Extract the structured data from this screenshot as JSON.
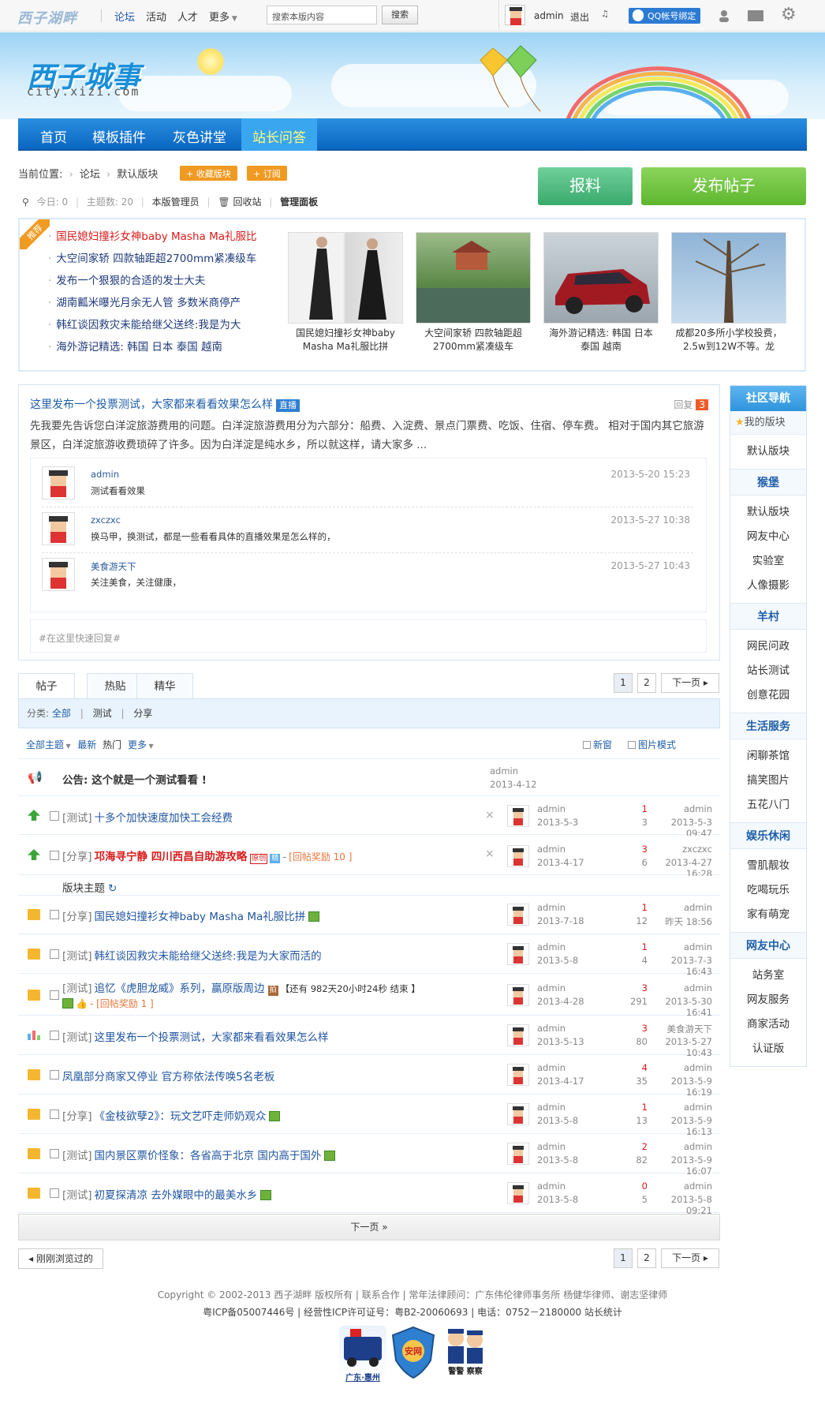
{
  "topbar": {
    "logo": "西子湖畔",
    "nav": [
      "论坛",
      "活动",
      "人才",
      "更多"
    ],
    "search_placeholder": "搜索本版内容",
    "search_button": "搜索",
    "user": "admin",
    "logout": "退出",
    "qq_bind": "QQ帐号绑定"
  },
  "banner": {
    "title": "西子城事",
    "subtitle": "city.xizi.com"
  },
  "mainnav": [
    "首页",
    "模板插件",
    "灰色讲堂",
    "站长问答"
  ],
  "crumb": {
    "label": "当前位置:",
    "forum": "论坛",
    "board": "默认版块",
    "fav": "+ 收藏版块",
    "sub": "+ 订阅"
  },
  "stats": {
    "today": "今日: 0",
    "topics": "主题数: 20",
    "admins": "本版管理员",
    "recycle": "回收站",
    "panel": "管理面板"
  },
  "buttons": {
    "report": "报料",
    "post": "发布帖子"
  },
  "recommend": {
    "tag": "推荐",
    "list": [
      "国民媳妇撞衫女神baby Masha Ma礼服比",
      "大空间家轿 四款轴距超2700mm紧凑级车",
      "发布一个狠狠的合适的发士大夫",
      "湖南瓤米曝光月余无人管 多数米商停产",
      "韩红谈因救灾未能给继父送终:我是为大",
      "海外游记精选: 韩国 日本 泰国 越南"
    ],
    "thumbs": [
      "国民媳妇撞衫女神baby Masha Ma礼服比拼",
      "大空间家轿 四款轴距超2700mm紧凑级车",
      "海外游记精选: 韩国 日本 泰国 越南",
      "成都20多所小学校投费，2.5w到12W不等。龙"
    ]
  },
  "sidebar": {
    "title": "社区导航",
    "fav": "我的版块",
    "fav_items": [
      "默认版块"
    ],
    "groups": [
      {
        "name": "猴堡",
        "items": [
          "默认版块",
          "网友中心",
          "实验室",
          "人像摄影"
        ]
      },
      {
        "name": "羊村",
        "items": [
          "网民问政",
          "站长测试",
          "创意花园"
        ]
      },
      {
        "name": "生活服务",
        "items": [
          "闲聊茶馆",
          "搞笑图片",
          "五花八门"
        ]
      },
      {
        "name": "娱乐休闲",
        "items": [
          "雪肌靓妆",
          "吃喝玩乐",
          "家有萌宠"
        ]
      },
      {
        "name": "网友中心",
        "items": [
          "站务室",
          "网友服务",
          "商家活动",
          "认证版"
        ]
      }
    ]
  },
  "post": {
    "title": "这里发布一个投票测试，大家都来看看效果怎么样",
    "live": "直播",
    "reply_label": "回复",
    "reply_count": "3",
    "body": "先我要先告诉您白洋淀旅游费用的问题。白洋淀旅游费用分为六部分：船费、入淀费、景点门票费、吃饭、住宿、停车费。 相对于国内其它旅游景区，白洋淀旅游收费琐碎了许多。因为白洋淀是纯水乡，所以就这样，请大家多 ...",
    "comments": [
      {
        "name": "admin",
        "text": "测试看看效果",
        "time": "2013-5-20 15:23"
      },
      {
        "name": "zxczxc",
        "text": "换马甲，换测试，都是一些看看具体的直播效果是怎么样的，",
        "time": "2013-5-27 10:38"
      },
      {
        "name": "美食游天下",
        "text": "关注美食，关注健康，",
        "time": "2013-5-27 10:43"
      }
    ],
    "quick_reply": "#在这里快速回复#"
  },
  "tabs": [
    "帖子",
    "热贴",
    "精华"
  ],
  "pager": {
    "p1": "1",
    "p2": "2",
    "next": "下一页"
  },
  "filter": {
    "label": "分类:",
    "all": "全部",
    "c1": "测试",
    "c2": "分享"
  },
  "listhead": {
    "all": "全部主题",
    "latest": "最新",
    "hot": "热门",
    "more": "更多",
    "newwin": "新窗",
    "picmode": "图片模式"
  },
  "announce": {
    "title": "公告: 这个就是一个测试看看 !",
    "author": "admin",
    "date": "2013-4-12"
  },
  "section_label": "版块主题",
  "rows": [
    {
      "cat": "[测试]",
      "title": "十多个加快速度加快工会经费",
      "author": "admin",
      "date": "2013-5-3",
      "replies": "1",
      "views": "3",
      "last_user": "admin",
      "last_date": "2013-5-3 09:47"
    },
    {
      "cat": "[分享]",
      "title": "邛海寻宁静 四川西昌自助游攻略",
      "extra": "[回帖奖励 10 ]",
      "author": "admin",
      "date": "2013-4-17",
      "replies": "3",
      "views": "6",
      "last_user": "zxczxc",
      "last_date": "2013-4-27 16:28"
    },
    {
      "cat": "[分享]",
      "title": "国民媳妇撞衫女神baby Masha Ma礼服比拼",
      "author": "admin",
      "date": "2013-7-18",
      "replies": "1",
      "views": "12",
      "last_user": "admin",
      "last_date": "昨天 18:56"
    },
    {
      "cat": "[测试]",
      "title": "韩红谈因救灾未能给继父送终:我是为大家而活的",
      "author": "admin",
      "date": "2013-5-8",
      "replies": "1",
      "views": "4",
      "last_user": "admin",
      "last_date": "2013-7-3 16:43"
    },
    {
      "cat": "[测试]",
      "title": "追忆《虎胆龙威》系列，赢原版周边",
      "extra": "【还有 982天20小时24秒 结束 】",
      "extra2": "- [回帖奖励 1 ]",
      "author": "admin",
      "date": "2013-4-28",
      "replies": "3",
      "views": "291",
      "last_user": "admin",
      "last_date": "2013-5-30 16:41"
    },
    {
      "cat": "[测试]",
      "title": "这里发布一个投票测试，大家都来看看效果怎么样",
      "author": "admin",
      "date": "2013-5-13",
      "replies": "3",
      "views": "80",
      "last_user": "美食游天下",
      "last_date": "2013-5-27 10:43"
    },
    {
      "cat": "",
      "title": "凤凰部分商家又停业 官方称依法传唤5名老板",
      "author": "admin",
      "date": "2013-4-17",
      "replies": "4",
      "views": "35",
      "last_user": "admin",
      "last_date": "2013-5-9 16:19"
    },
    {
      "cat": "[分享]",
      "title": "《金枝欲孽2》：玩文艺吓走师奶观众",
      "author": "admin",
      "date": "2013-5-8",
      "replies": "1",
      "views": "13",
      "last_user": "admin",
      "last_date": "2013-5-9 16:13"
    },
    {
      "cat": "[测试]",
      "title": "国内景区票价怪象：各省高于北京 国内高于国外",
      "author": "admin",
      "date": "2013-5-8",
      "replies": "2",
      "views": "82",
      "last_user": "admin",
      "last_date": "2013-5-9 16:07"
    },
    {
      "cat": "[测试]",
      "title": "初夏探清凉 去外媒眼中的最美水乡",
      "author": "admin",
      "date": "2013-5-8",
      "replies": "0",
      "views": "5",
      "last_user": "admin",
      "last_date": "2013-5-8 09:21"
    }
  ],
  "nextbar": "下一页 »",
  "back": "刚刚浏览过的",
  "footer": {
    "line1": "Copyright © 2002-2013 西子湖畔 版权所有 | 联系合作 | 常年法律顾问：广东伟伦律师事务所 杨健华律师、谢志坚律师",
    "line2": "粤ICP备05007446号 | 经营性ICP许可证号：粤B2-20060693 | 电话：0752－2180000 站长统计",
    "badges": [
      "广东·惠州",
      "安网",
      "警警 察察"
    ]
  }
}
